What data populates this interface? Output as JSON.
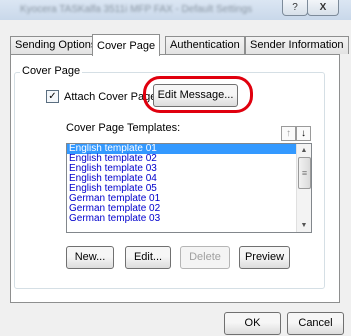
{
  "window": {
    "title": "Kyocera TASKalfa 3511i MFP FAX - Default Settings",
    "help_label": "?",
    "close_label": "X"
  },
  "tabs": [
    {
      "label": "Sending Options"
    },
    {
      "label": "Cover Page",
      "active": true
    },
    {
      "label": "Authentication"
    },
    {
      "label": "Sender Information"
    }
  ],
  "cover_page": {
    "group_label": "Cover Page",
    "attach_label": "Attach Cover Page",
    "attach_checked": true,
    "check_mark": "✓",
    "edit_message_label": "Edit Message...",
    "templates_label": "Cover Page Templates:",
    "sort_up_icon": "↑",
    "sort_down_icon": "↓",
    "templates": [
      "English template 01",
      "English template 02",
      "English template 03",
      "English template 04",
      "English template 05",
      "German template 01",
      "German template 02",
      "German template 03"
    ],
    "selected_index": 0,
    "buttons": {
      "new": "New...",
      "edit": "Edit...",
      "delete": "Delete",
      "preview": "Preview"
    }
  },
  "footer": {
    "ok": "OK",
    "cancel": "Cancel"
  },
  "colors": {
    "highlight": "#e0000e",
    "selection": "#3399ff",
    "list_text": "#0000cc"
  }
}
